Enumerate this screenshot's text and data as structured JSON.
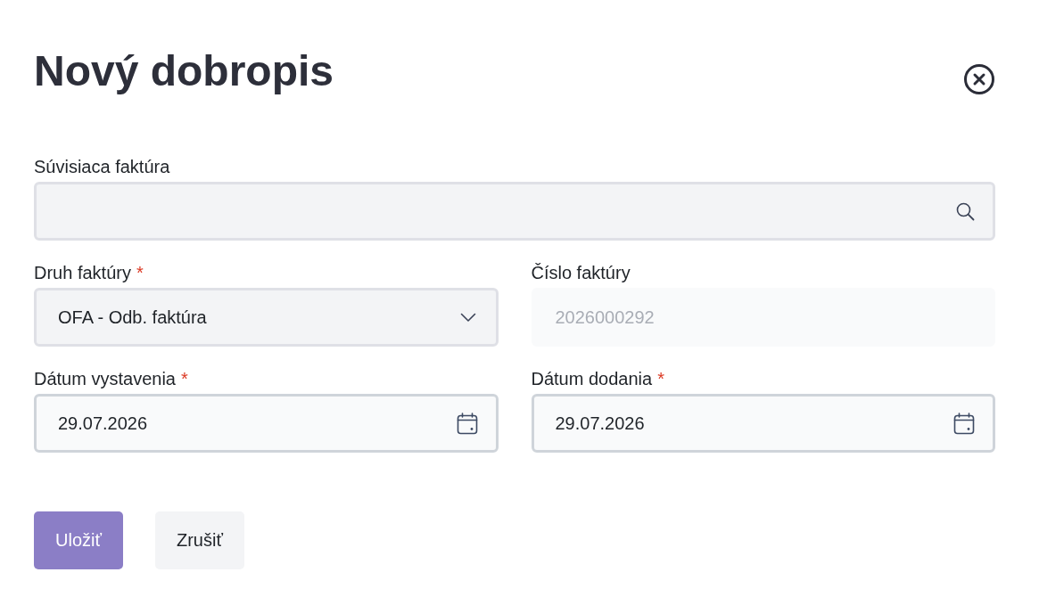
{
  "dialog": {
    "title": "Nový dobropis"
  },
  "fields": [
    {
      "kind": "search",
      "label": "Súvisiaca faktúra",
      "disabled": false
    },
    {
      "kind": "select",
      "label": "Druh faktúry",
      "required_mark": "*",
      "value": "OFA - Odb. faktúra",
      "disabled": false
    },
    {
      "kind": "text",
      "label": "Číslo faktúry",
      "value": "2026000292",
      "disabled": true
    },
    {
      "kind": "date",
      "label": "Dátum vystavenia",
      "required_mark": "*",
      "value": "29.07.2026",
      "disabled": false
    },
    {
      "kind": "date",
      "label": "Dátum dodania",
      "required_mark": "*",
      "value": "29.07.2026",
      "disabled": false
    }
  ],
  "buttons": [
    {
      "kind": "primary",
      "label": "Uložiť"
    },
    {
      "kind": "secondary",
      "label": "Zrušiť"
    }
  ]
}
